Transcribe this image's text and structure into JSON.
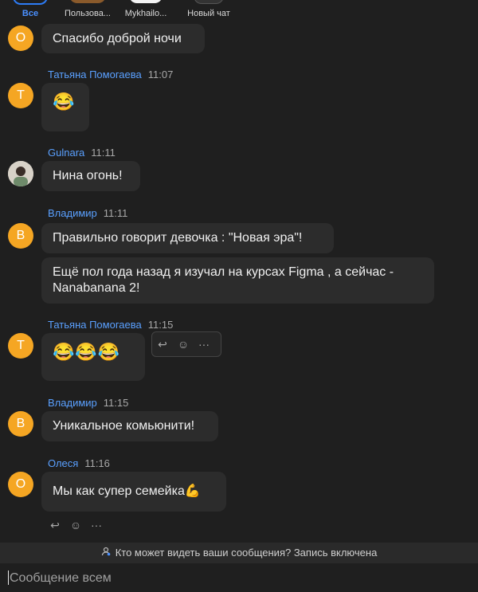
{
  "tabs": [
    {
      "label": "Все",
      "active": true
    },
    {
      "label": "Пользова..."
    },
    {
      "label": "Mykhailo..."
    },
    {
      "label": "Новый чат"
    }
  ],
  "messages": [
    {
      "avatar_letter": "О",
      "text": "Спасибо доброй ночи"
    },
    {
      "sender": "Татьяна Помогаева",
      "time": "11:07",
      "avatar_letter": "Т",
      "emoji": "😂"
    },
    {
      "sender": "Gulnara",
      "time": "11:11",
      "avatar": "photo-avatar",
      "text": "Нина огонь!"
    },
    {
      "sender": "Владимир",
      "time": "11:11",
      "avatar_letter": "В",
      "text": "Правильно говорит девочка : \"Новая эра\"!",
      "text2_line1": "Ещё пол года назад я изучал на курсах  Figma , а сейчас -",
      "text2_line2": "Nanabanana 2!"
    },
    {
      "sender": "Татьяна Помогаева",
      "time": "11:15",
      "avatar_letter": "Т",
      "emoji": "😂😂😂"
    },
    {
      "sender": "Владимир",
      "time": "11:15",
      "avatar_letter": "В",
      "text": "Уникальное комьюнити!"
    },
    {
      "sender": "Олеся",
      "time": "11:16",
      "avatar_letter": "О",
      "text": "Мы как супер семейка💪"
    }
  ],
  "actions": {
    "reply": "↩︎",
    "react": "☺︎",
    "more": "···"
  },
  "notice": {
    "text": "Кто может видеть ваши сообщения? Запись включена",
    "icon": "person-lock-icon"
  },
  "composer": {
    "placeholder": "Сообщение всем"
  },
  "colors": {
    "accent": "#2d7cf6",
    "avatar": "#f5a623",
    "sender": "#5aa0ff"
  }
}
